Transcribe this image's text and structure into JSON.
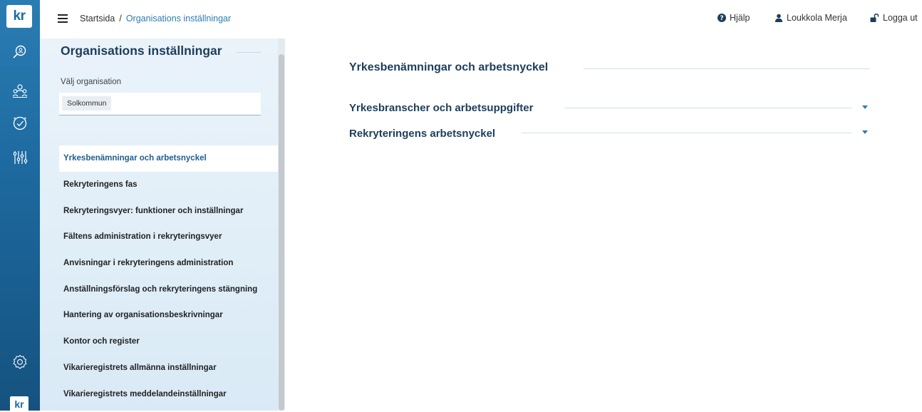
{
  "app": {
    "logo_text": "kr",
    "accent": "#2a7db3"
  },
  "rail": {
    "icons": [
      "search-icon",
      "recruitment-group-icon",
      "clock-icon",
      "sliders-icon",
      "settings-gear-icon"
    ]
  },
  "topbar": {
    "breadcrumb": {
      "home": "Startsida",
      "separator": "/",
      "current": "Organisations inställningar"
    },
    "help_label": "Hjälp",
    "user_label": "Loukkola Merja",
    "logout_label": "Logga ut"
  },
  "sidebar": {
    "title": "Organisations inställningar",
    "org_label": "Välj organisation",
    "org_selected": "Solkommun",
    "items": [
      {
        "label": "Yrkesbenämningar och arbetsnyckel",
        "active": true
      },
      {
        "label": "Rekryteringens fas"
      },
      {
        "label": "Rekryteringsvyer: funktioner och inställningar"
      },
      {
        "label": "Fältens administration i rekryteringsvyer"
      },
      {
        "label": "Anvisningar i rekryteringens administration"
      },
      {
        "label": "Anställningsförslag och rekryteringens stängning"
      },
      {
        "label": "Hantering av organisationsbeskrivningar"
      },
      {
        "label": "Kontor och register"
      },
      {
        "label": "Vikarieregistrets allmänna inställningar"
      },
      {
        "label": "Vikarieregistrets meddelandeinställningar"
      }
    ]
  },
  "main": {
    "title": "Yrkesbenämningar och arbetsnyckel",
    "sections": [
      {
        "label": "Yrkesbranscher och arbetsuppgifter"
      },
      {
        "label": "Rekryteringens arbetsnyckel"
      }
    ]
  }
}
